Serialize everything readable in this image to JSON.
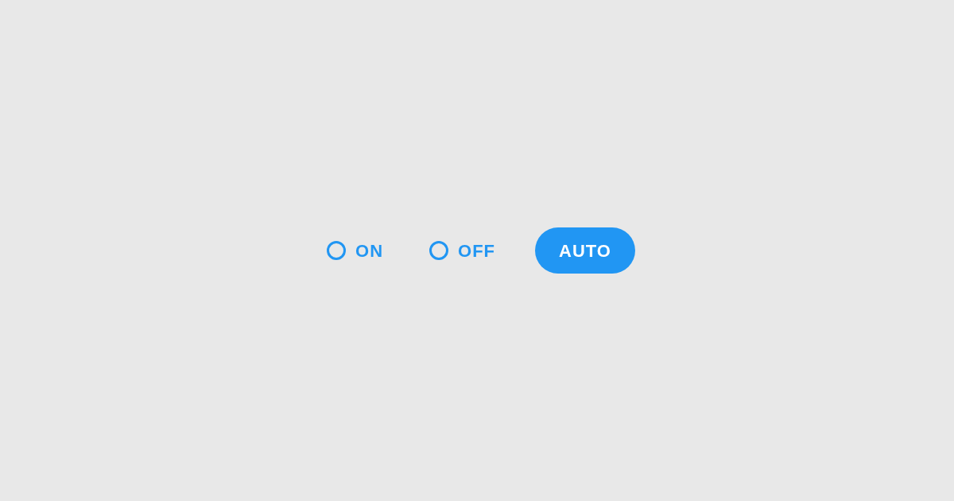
{
  "options": [
    {
      "label": "ON",
      "selected": false
    },
    {
      "label": "OFF",
      "selected": false
    },
    {
      "label": "AUTO",
      "selected": true
    }
  ]
}
